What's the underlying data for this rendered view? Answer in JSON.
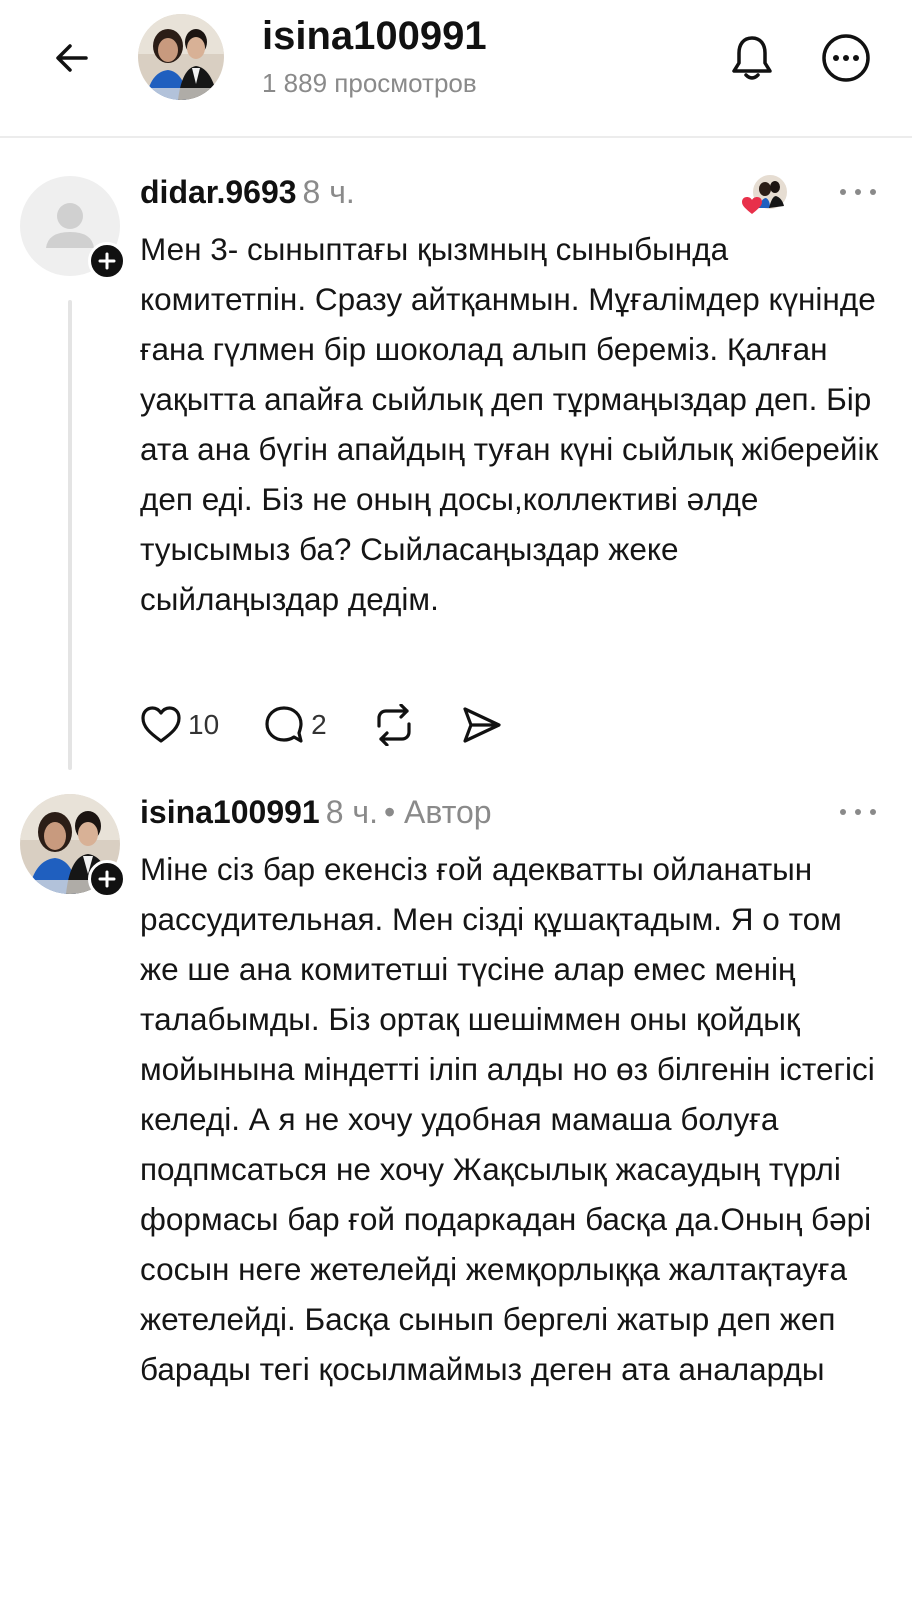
{
  "header": {
    "title": "isina100991",
    "views": "1 889 просмотров"
  },
  "comments": [
    {
      "username": "didar.9693",
      "time": "8 ч.",
      "author_tag": "",
      "text": "Мен 3- сыныптағы қызмның сыныбында комитетпін. Сразу айтқанмын. Мұғалімдер күнінде ғана гүлмен бір шоколад алып береміз. Қалған уақытта апайға сыйлық деп тұрмаңыздар деп. Бір ата ана бүгін апайдың туған күні сыйлық жіберейік деп еді. Біз не оның досы,коллективі  әлде туысымыз ба? Сыйласаңыздар жеке сыйлаңыздар дедім.",
      "likes": "10",
      "replies": "2"
    },
    {
      "username": "isina100991",
      "time": "8 ч.",
      "author_tag": "• Автор",
      "text": "Міне сіз бар екенсіз ғой адекватты ойланатын рассудительная. Мен сізді құшақтадым. Я о том же ше ана комитетші түсіне алар емес менің талабымды. Біз ортақ шешіммен оны қойдық мойынына міндетті іліп алды но өз білгенін істегісі келеді. А я не хочу удобная мамаша болуға подпмсаться не хочу Жақсылық жасаудың түрлі формасы бар ғой подаркадан басқа да.Оның бәрі сосын неге жетелейді жемқорлыққа жалтақтауға жетелейді. Басқа сынып бергелі жатыр деп жеп барады тегі қосылмаймыз деген ата аналарды"
    }
  ],
  "colors": {
    "text": "#111111",
    "muted": "#8a8a8a",
    "heart_red": "#e8304a"
  },
  "icons": [
    "back-arrow-icon",
    "bell-icon",
    "more-circle-icon",
    "plus-icon",
    "heart-icon",
    "reply-bubble-icon",
    "repost-icon",
    "share-icon",
    "more-dots-icon"
  ]
}
